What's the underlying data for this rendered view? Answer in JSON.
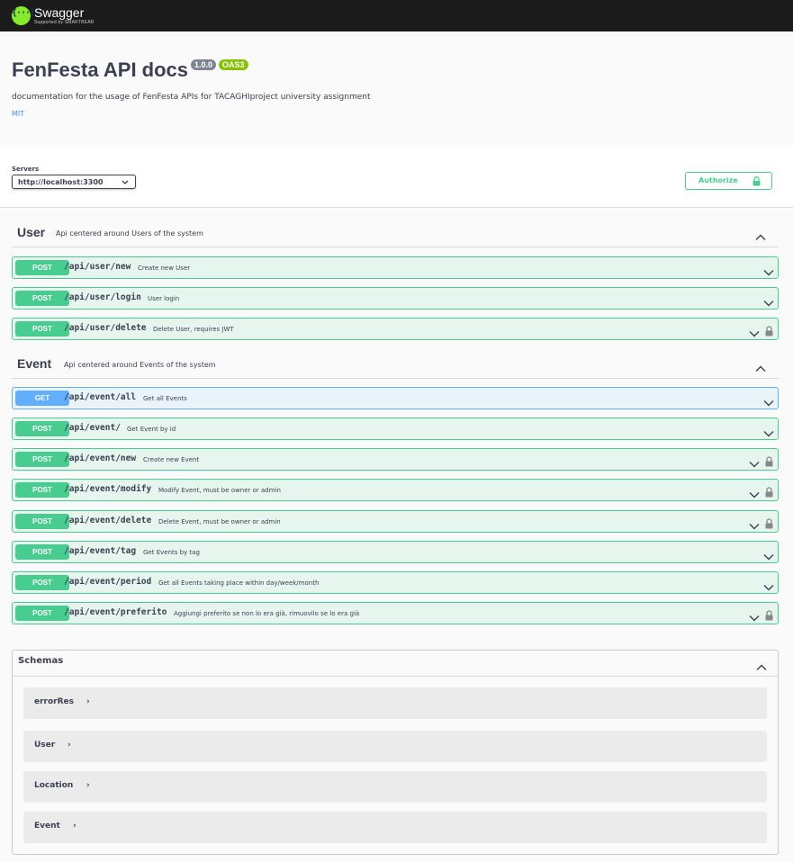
{
  "app": {
    "name": "Swagger",
    "subtitle": "Supported by SMARTBEAR",
    "logo_glyph": "{···}"
  },
  "info": {
    "title": "FenFesta API docs",
    "version": "1.0.0",
    "spec": "OAS3",
    "description": "documentation for the usage of FenFesta APIs for TACAGHIproject university assignment",
    "license": "MIT"
  },
  "servers": {
    "label": "Servers",
    "selected": "http://localhost:3300"
  },
  "authorize": {
    "label": "Authorize",
    "icon": "lock-icon"
  },
  "colors": {
    "post": "#49cc90",
    "get": "#61affe",
    "topbar": "#1b1b1b",
    "brand": "#85ea2d"
  },
  "tags": [
    {
      "name": "User",
      "description": "Api centered around Users of the system",
      "operations": [
        {
          "method": "POST",
          "path": "/api/user/new",
          "summary": "Create new User",
          "locked": false
        },
        {
          "method": "POST",
          "path": "/api/user/login",
          "summary": "User login",
          "locked": false
        },
        {
          "method": "POST",
          "path": "/api/user/delete",
          "summary": "Delete User, requires JWT",
          "locked": true
        }
      ]
    },
    {
      "name": "Event",
      "description": "Api centered around Events of the system",
      "operations": [
        {
          "method": "GET",
          "path": "/api/event/all",
          "summary": "Get all Events",
          "locked": false
        },
        {
          "method": "POST",
          "path": "/api/event/",
          "summary": "Get Event by id",
          "locked": false
        },
        {
          "method": "POST",
          "path": "/api/event/new",
          "summary": "Create new Event",
          "locked": true
        },
        {
          "method": "POST",
          "path": "/api/event/modify",
          "summary": "Modify Event, must be owner or admin",
          "locked": true
        },
        {
          "method": "POST",
          "path": "/api/event/delete",
          "summary": "Delete Event, must be owner or admin",
          "locked": true
        },
        {
          "method": "POST",
          "path": "/api/event/tag",
          "summary": "Get Events by tag",
          "locked": false
        },
        {
          "method": "POST",
          "path": "/api/event/period",
          "summary": "Get all Events taking place within day/week/month",
          "locked": false
        },
        {
          "method": "POST",
          "path": "/api/event/preferito",
          "summary": "Aggiungi preferito se non lo era già, rimuovilo se lo era già",
          "locked": true
        }
      ]
    }
  ],
  "schemas": {
    "title": "Schemas",
    "models": [
      "errorRes",
      "User",
      "Location",
      "Event"
    ]
  }
}
